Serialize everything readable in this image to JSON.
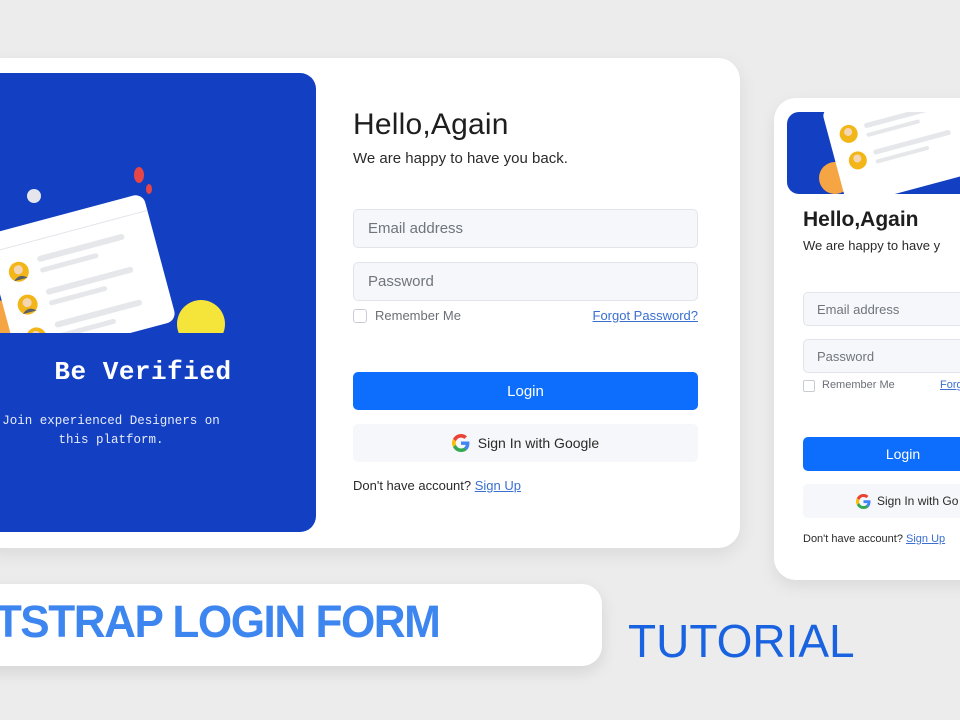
{
  "colors": {
    "brand_blue_panel": "#1340c2",
    "primary_button": "#0d6efd",
    "link": "#3a6fd0",
    "title_blue": "#3e86ef",
    "tutorial_blue": "#1a63e0",
    "yellow_circle": "#f5e53a",
    "orange_circle": "#f5a543",
    "red_drops": "#e84545"
  },
  "left_panel": {
    "heading": "Be Verified",
    "description": "Join experienced Designers on this platform.",
    "illustration": "user-list-card-icon"
  },
  "main_form": {
    "title": "Hello,Again",
    "subtitle": "We are happy to have you back.",
    "email_placeholder": "Email address",
    "password_placeholder": "Password",
    "remember_label": "Remember Me",
    "remember_checked": false,
    "forgot_link": "Forgot Password?",
    "login_label": "Login",
    "google_label": "Sign In with Google",
    "google_icon": "google-g-icon",
    "no_account_text": "Don't have account?",
    "signup_link": "Sign Up"
  },
  "mobile_form": {
    "title": "Hello,Again",
    "subtitle": "We are happy to have y",
    "email_placeholder": "Email address",
    "password_placeholder": "Password",
    "remember_label": "Remember Me",
    "forgot_link": "Forg",
    "login_label": "Login",
    "google_label": "Sign In with Go",
    "no_account_text": "Don't have account?",
    "signup_link": "Sign Up"
  },
  "banner": {
    "title": "OTSTRAP LOGIN FORM",
    "subtitle": "TUTORIAL"
  }
}
